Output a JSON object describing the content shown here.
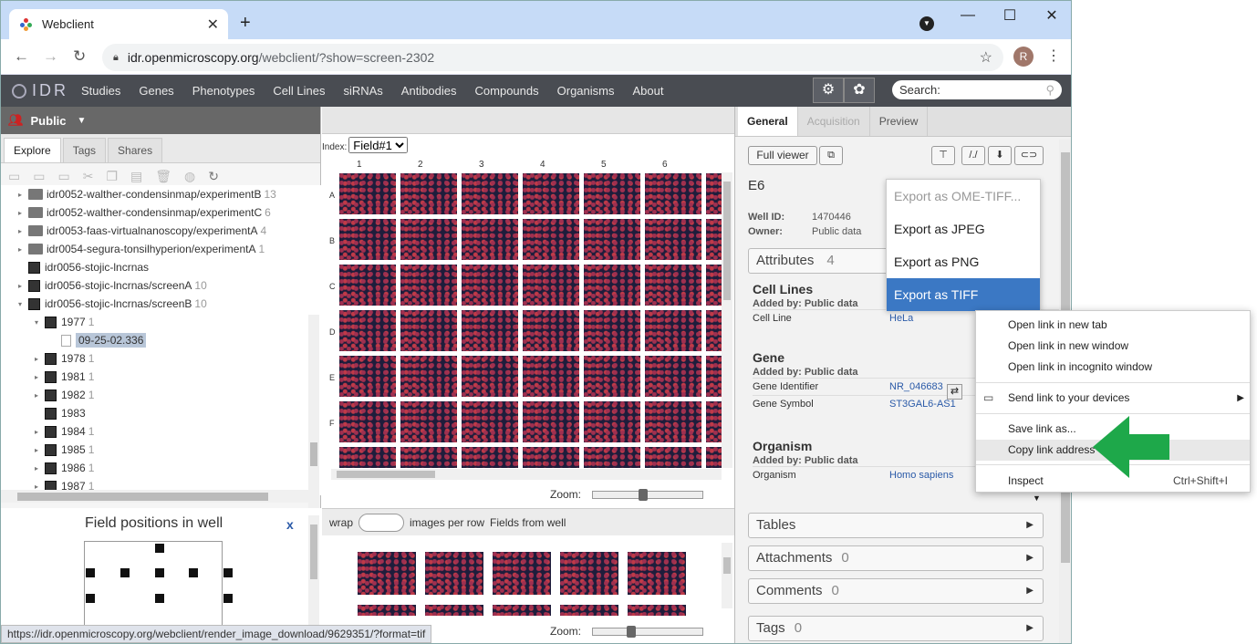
{
  "browser": {
    "tab_title": "Webclient",
    "new_tab": "+",
    "url_host": "idr.openmicroscopy.org",
    "url_path": "/webclient/?show=screen-2302",
    "profile_initial": "R",
    "status_url": "https://idr.openmicroscopy.org/webclient/render_image_download/9629351/?format=tif"
  },
  "idr_nav": {
    "logo": "IDR",
    "items": [
      "Studies",
      "Genes",
      "Phenotypes",
      "Cell Lines",
      "siRNAs",
      "Antibodies",
      "Compounds",
      "Organisms",
      "About"
    ],
    "search_placeholder": "Search:"
  },
  "left": {
    "user": "Public",
    "tabs": [
      "Explore",
      "Tags",
      "Shares"
    ],
    "tree": [
      {
        "label": "idr0052-walther-condensinmap/experimentB",
        "count": "13",
        "kind": "folder",
        "arrow": "▸",
        "indent": 28
      },
      {
        "label": "idr0052-walther-condensinmap/experimentC",
        "count": "6",
        "kind": "folder",
        "arrow": "▸",
        "indent": 28
      },
      {
        "label": "idr0053-faas-virtualnanoscopy/experimentA",
        "count": "4",
        "kind": "folder",
        "arrow": "▸",
        "indent": 28
      },
      {
        "label": "idr0054-segura-tonsilhyperion/experimentA",
        "count": "1",
        "kind": "folder",
        "arrow": "▸",
        "indent": 28
      },
      {
        "label": "idr0056-stojic-lncrnas",
        "count": "",
        "kind": "plate",
        "arrow": "",
        "indent": 28
      },
      {
        "label": "idr0056-stojic-lncrnas/screenA",
        "count": "10",
        "kind": "plate",
        "arrow": "▸",
        "indent": 28
      },
      {
        "label": "idr0056-stojic-lncrnas/screenB",
        "count": "10",
        "kind": "plate",
        "arrow": "▾",
        "indent": 28
      },
      {
        "label": "1977",
        "count": "1",
        "kind": "plate",
        "arrow": "▾",
        "indent": 46
      },
      {
        "label": "09-25-02.336",
        "count": "",
        "kind": "file",
        "arrow": "",
        "indent": 64,
        "selected": true
      },
      {
        "label": "1978",
        "count": "1",
        "kind": "plate",
        "arrow": "▸",
        "indent": 46
      },
      {
        "label": "1981",
        "count": "1",
        "kind": "plate",
        "arrow": "▸",
        "indent": 46
      },
      {
        "label": "1982",
        "count": "1",
        "kind": "plate",
        "arrow": "▸",
        "indent": 46
      },
      {
        "label": "1983",
        "count": "",
        "kind": "plate",
        "arrow": "",
        "indent": 46
      },
      {
        "label": "1984",
        "count": "1",
        "kind": "plate",
        "arrow": "▸",
        "indent": 46
      },
      {
        "label": "1985",
        "count": "1",
        "kind": "plate",
        "arrow": "▸",
        "indent": 46
      },
      {
        "label": "1986",
        "count": "1",
        "kind": "plate",
        "arrow": "▸",
        "indent": 46
      },
      {
        "label": "1987",
        "count": "1",
        "kind": "plate",
        "arrow": "▸",
        "indent": 46
      }
    ],
    "field_positions_title": "Field positions in well",
    "field_positions_close": "x"
  },
  "center": {
    "index_label": "Index:",
    "index_value": "Field#1",
    "columns": [
      "1",
      "2",
      "3",
      "4",
      "5",
      "6"
    ],
    "rows": [
      "A",
      "B",
      "C",
      "D",
      "E",
      "F"
    ],
    "zoom_label": "Zoom:",
    "zoom_level_top": 0.45,
    "zoom_level_bottom": 0.33,
    "wrap_label": "wrap",
    "images_per_row": "images per row",
    "fields_from_well": "Fields from well"
  },
  "right": {
    "tabs": [
      "General",
      "Acquisition",
      "Preview"
    ],
    "full_viewer": "Full viewer",
    "well_name": "E6",
    "well_id_label": "Well ID:",
    "well_id": "1470446",
    "owner_label": "Owner:",
    "owner": "Public data",
    "attributes_label": "Attributes",
    "attributes_count": "4",
    "annotations": [
      {
        "heading": "Cell Lines",
        "added_by": "Added by: Public data",
        "rows": [
          {
            "k": "Cell Line",
            "v": "HeLa"
          }
        ]
      },
      {
        "heading": "Gene",
        "added_by": "Added by: Public data",
        "rows": [
          {
            "k": "Gene Identifier",
            "v": "NR_046683"
          },
          {
            "k": "Gene Symbol",
            "v": "ST3GAL6-AS1"
          }
        ]
      },
      {
        "heading": "Organism",
        "added_by": "Added by: Public data",
        "rows": [
          {
            "k": "Organism",
            "v": "Homo sapiens"
          }
        ]
      }
    ],
    "sections": [
      {
        "label": "Tables",
        "count": ""
      },
      {
        "label": "Attachments",
        "count": "0"
      },
      {
        "label": "Comments",
        "count": "0"
      },
      {
        "label": "Tags",
        "count": "0"
      }
    ]
  },
  "export_menu": [
    "Export as OME-TIFF...",
    "Export as JPEG",
    "Export as PNG",
    "Export as TIFF"
  ],
  "context_menu": {
    "open_new_tab": "Open link in new tab",
    "open_new_window": "Open link in new window",
    "open_incognito": "Open link in incognito window",
    "send_to_devices": "Send link to your devices",
    "save_link": "Save link as...",
    "copy_link": "Copy link address",
    "inspect": "Inspect",
    "inspect_shortcut": "Ctrl+Shift+I"
  },
  "colors": {
    "accent_arrow": "#1ea84a",
    "nav_bg": "#494c52",
    "selected_menu": "#3b78c4"
  }
}
